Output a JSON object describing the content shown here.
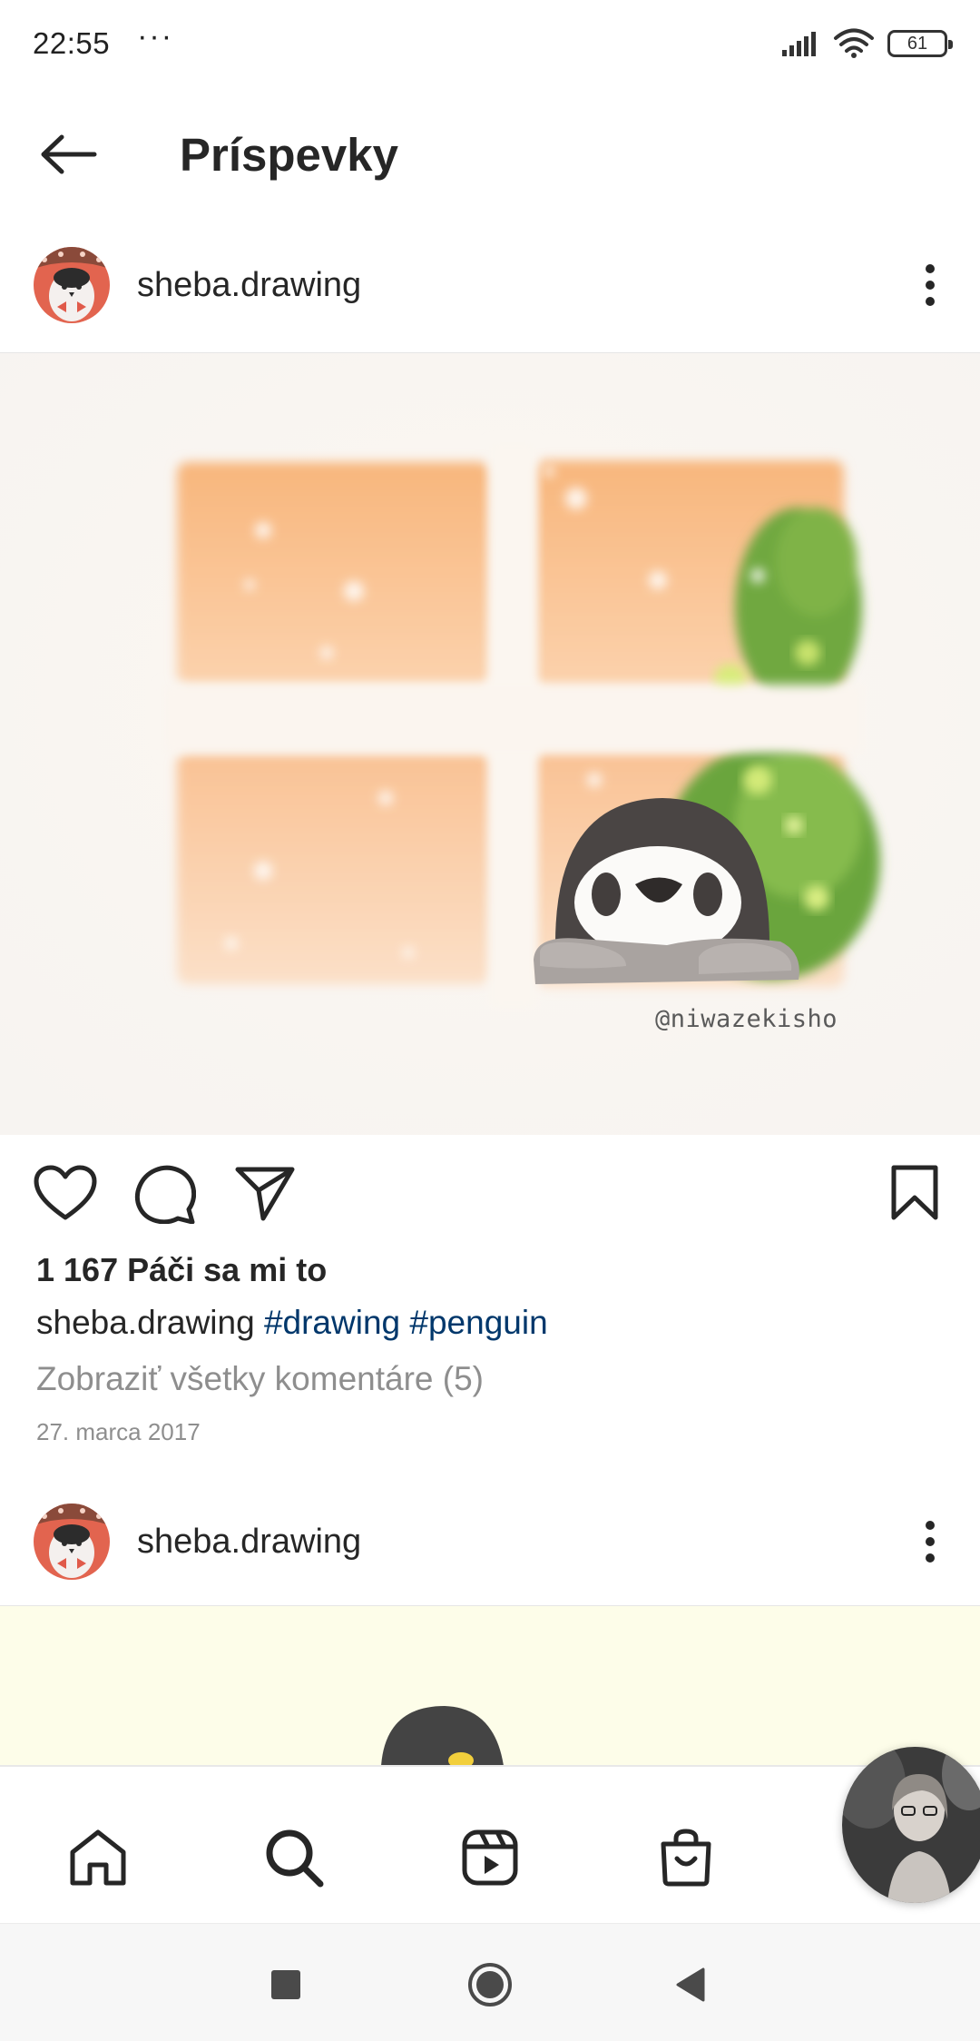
{
  "status_bar": {
    "time": "22:55",
    "dots": "···",
    "battery": "61"
  },
  "header": {
    "title": "Príspevky"
  },
  "post1": {
    "username": "sheba.drawing",
    "image_watermark": "@niwazekisho",
    "likes": "1 167 Páči sa mi to",
    "caption_user": "sheba.drawing",
    "hashtags": [
      "#drawing",
      "#penguin"
    ],
    "view_comments": "Zobraziť všetky komentáre (5)",
    "date": "27. marca 2017"
  },
  "post2": {
    "username": "sheba.drawing"
  },
  "colors": {
    "text": "#262626",
    "secondary": "#8e8e8e",
    "hashtag": "#00376b",
    "image_window": "#f8b984",
    "image_tree": "#7fb347"
  },
  "icons": {
    "back": "arrow-left-icon",
    "more": "more-vertical-icon",
    "like": "heart-icon",
    "comment": "comment-icon",
    "share": "paper-plane-icon",
    "save": "bookmark-icon",
    "home": "home-icon",
    "search": "search-icon",
    "reels": "reels-icon",
    "shop": "shopping-bag-icon",
    "sys_recents": "square-icon",
    "sys_home": "circle-icon",
    "sys_back": "triangle-back-icon"
  }
}
